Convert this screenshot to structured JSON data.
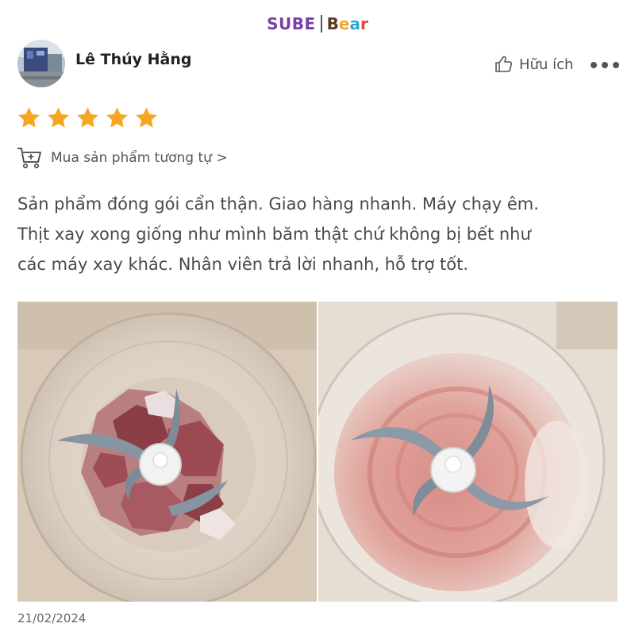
{
  "brand": {
    "left": "SUBE",
    "right_parts": [
      "B",
      "e",
      "a",
      "r"
    ]
  },
  "review": {
    "reviewer_name": "Lê Thúy Hằng",
    "rating": 5,
    "rating_max": 5,
    "helpful_label": "Hữu ích",
    "buy_similar_label": "Mua sản phẩm tương tự >",
    "text_lines": [
      "Sản phẩm đóng gói cẩn thận. Giao hàng nhanh. Máy chạy êm.",
      "Thịt xay xong giống như mình băm thật chứ không bị bết như",
      "các máy xay khác. Nhân viên trả lời nhanh, hỗ trợ tốt."
    ],
    "date": "21/02/2024",
    "photo_count": 2
  },
  "colors": {
    "star": "#f5a623",
    "brand_purple": "#7a3fa6",
    "text": "#4a4a4a"
  },
  "icons": {
    "helpful": "thumbs-up-icon",
    "more": "more-horizontal-icon",
    "buy": "cart-plus-icon",
    "star": "star-icon"
  }
}
